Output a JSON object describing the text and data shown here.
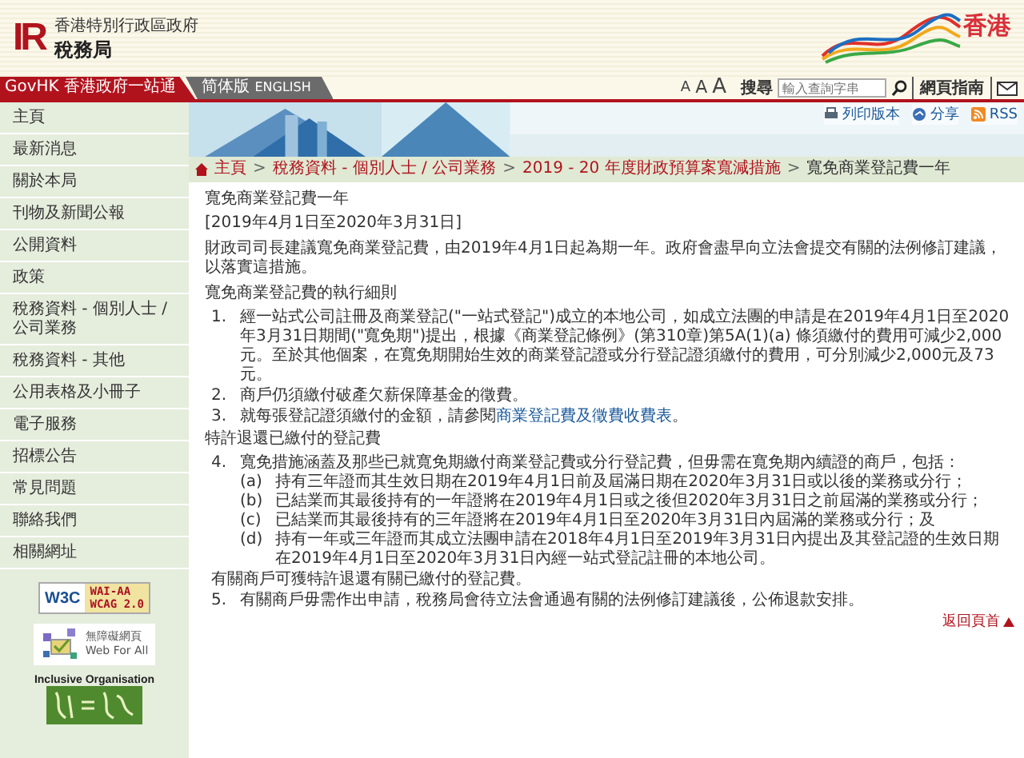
{
  "header": {
    "logo_mark": "IR",
    "agency_line": "香港特別行政區政府",
    "agency_name": "稅務局",
    "brand": "香港"
  },
  "nav": {
    "govhk": "GovHK 香港政府一站通",
    "simplified": "简体版",
    "english": "ENGLISH",
    "font_sizes": [
      "A",
      "A",
      "A"
    ],
    "search_label": "搜尋",
    "search_placeholder": "輸入查詢字串",
    "guide": "網頁指南"
  },
  "tools": [
    "列印版本",
    "分享",
    "RSS"
  ],
  "sidebar": {
    "items": [
      "主頁",
      "最新消息",
      "關於本局",
      "刊物及新聞公報",
      "公開資料",
      "政策",
      "稅務資料 - 個別人士 / 公司業務",
      "稅務資料 - 其他",
      "公用表格及小冊子",
      "電子服務",
      "招標公告",
      "常見問題",
      "聯絡我們",
      "相關網址"
    ],
    "badges": {
      "w3c": [
        "W3C",
        "WAI-AA",
        "WCAG 2.0"
      ],
      "web_for_all": [
        "無障礙網頁",
        "Web For All"
      ],
      "inclusive": "Inclusive Organisation"
    }
  },
  "breadcrumb": [
    {
      "text": "主頁",
      "current": false
    },
    {
      "sep": ">",
      "text": "稅務資料 - 個別人士 / 公司業務",
      "current": false
    },
    {
      "sep": ">",
      "text": "2019 - 20 年度財政預算案寬減措施",
      "current": false
    },
    {
      "sep": ">",
      "text": "寬免商業登記費一年",
      "current": true
    }
  ],
  "article": [
    {
      "kind": "heading",
      "text": "寬免商業登記費一年"
    },
    {
      "kind": "para",
      "text": "[2019年4月1日至2020年3月31日]"
    },
    {
      "kind": "para",
      "text": "財政司司長建議寬免商業登記費，由2019年4月1日起為期一年。政府會盡早向立法會提交有關的法例修訂建議，以落實這措施。"
    },
    {
      "kind": "heading",
      "text": "寬免商業登記費的執行細則"
    },
    {
      "kind": "item",
      "num": "1.",
      "text": "經一站式公司註冊及商業登記(\"一站式登記\")成立的本地公司，如成立法團的申請是在2019年4月1日至2020年3月31日期間(\"寬免期\")提出，根據《商業登記條例》(第310章)第5A(1)(a) 條須繳付的費用可減少2,000元。至於其他個案，在寬免期開始生效的商業登記證或分行登記證須繳付的費用，可分別減少2,000元及73元。"
    },
    {
      "kind": "item",
      "num": "2.",
      "text": "商戶仍須繳付破產欠薪保障基金的徵費。"
    },
    {
      "kind": "item",
      "num": "3.",
      "text": "就每張登記證須繳付的金額，請參閱",
      "link": "商業登記費及徵費收費表",
      "after": "。"
    },
    {
      "kind": "heading",
      "text": "特許退還已繳付的登記費"
    },
    {
      "kind": "item",
      "num": "4.",
      "text": "寬免措施涵蓋及那些已就寬免期繳付商業登記費或分行登記費，但毋需在寬免期內續證的商戶，包括：",
      "subitems": [
        {
          "num": "(a)",
          "text": "持有三年證而其生效日期在2019年4月1日前及屆滿日期在2020年3月31日或以後的業務或分行；"
        },
        {
          "num": "(b)",
          "text": "已結業而其最後持有的一年證將在2019年4月1日或之後但2020年3月31日之前屆滿的業務或分行；"
        },
        {
          "num": "(c)",
          "text": "已結業而其最後持有的三年證將在2019年4月1日至2020年3月31日內屆滿的業務或分行；及"
        },
        {
          "num": "(d)",
          "text": "持有一年或三年證而其成立法團申請在2018年4月1日至2019年3月31日內提出及其登記證的生效日期在2019年4月1日至2020年3月31日內經一站式登記註冊的本地公司。"
        }
      ],
      "note": "有關商戶可獲特許退還有關已繳付的登記費。"
    },
    {
      "kind": "item",
      "num": "5.",
      "text": "有關商戶毋需作出申請，稅務局會待立法會通過有關的法例修訂建議後，公佈退款安排。"
    }
  ],
  "back_to_top": "返回頁首"
}
